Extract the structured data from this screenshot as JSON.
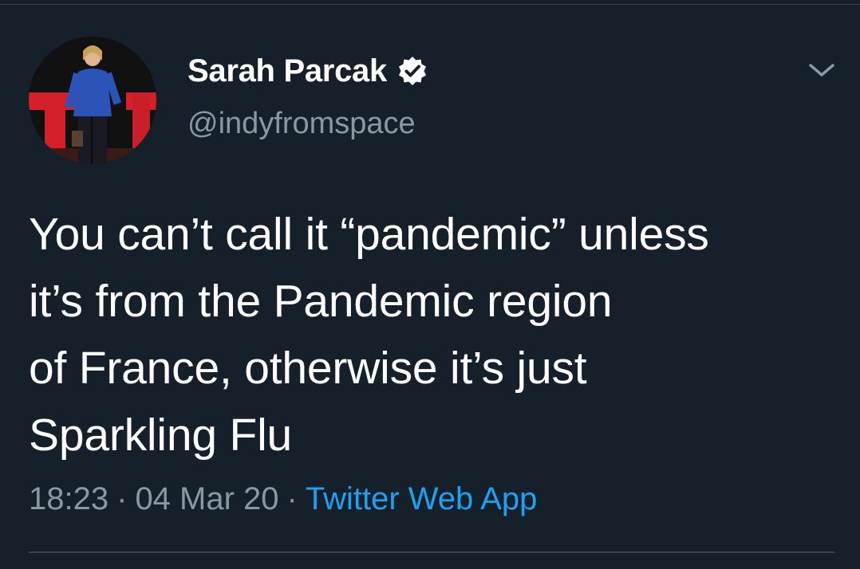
{
  "tweet": {
    "author": {
      "display_name": "Sarah Parcak",
      "handle": "@indyfromspace",
      "verified": true,
      "avatar_icon": "profile-photo-speaker-on-stage"
    },
    "text": "You can’t call it “pandemic” unless\nit’s from the Pandemic region\nof France, otherwise it’s just\nSparkling Flu",
    "meta": {
      "time": "18:23",
      "separator": "·",
      "date": "04 Mar 20",
      "source": "Twitter Web App"
    },
    "menu_icon": "chevron-down-icon"
  },
  "colors": {
    "background": "#15202b",
    "primary_text": "#ffffff",
    "secondary_text": "#8899a6",
    "link": "#1da1f2",
    "divider": "#38444d"
  }
}
